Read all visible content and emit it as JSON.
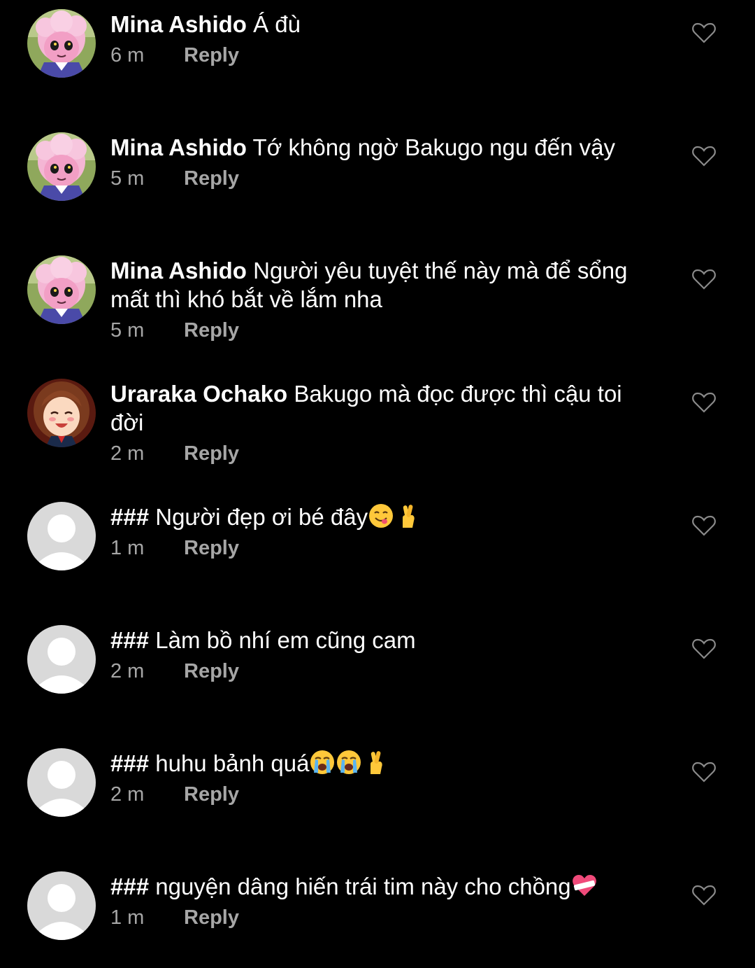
{
  "reply_label": "Reply",
  "comments": [
    {
      "author": "Mina Ashido",
      "text": "Á đù",
      "time": "6 m",
      "avatar": "pink-anime-avatar",
      "emojis": []
    },
    {
      "author": "Mina Ashido",
      "text": "Tớ không ngờ Bakugo ngu đến vậy",
      "time": "5 m",
      "avatar": "pink-anime-avatar",
      "emojis": []
    },
    {
      "author": "Mina Ashido",
      "text": "Người yêu tuyệt thế này mà để sổng mất thì khó bắt về lắm nha",
      "time": "5 m",
      "avatar": "pink-anime-avatar",
      "emojis": []
    },
    {
      "author": "Uraraka Ochako",
      "text": "Bakugo mà đọc được thì cậu toi đời",
      "time": "2 m",
      "avatar": "brown-hair-anime-avatar",
      "emojis": []
    },
    {
      "author": "###",
      "text": "Người đẹp ơi bé đây",
      "time": "1 m",
      "avatar": "default-avatar",
      "emojis": [
        "yum-face-emoji",
        "crossed-fingers-emoji"
      ]
    },
    {
      "author": "###",
      "text": "Làm bồ nhí em cũng cam",
      "time": "2 m",
      "avatar": "default-avatar",
      "emojis": []
    },
    {
      "author": "###",
      "text": "huhu bảnh quá",
      "time": "2 m",
      "avatar": "default-avatar",
      "emojis": [
        "crying-face-emoji",
        "crying-face-emoji",
        "crossed-fingers-emoji"
      ]
    },
    {
      "author": "###",
      "text": "nguyện dâng hiến trái tim này cho chồng",
      "time": "1 m",
      "avatar": "default-avatar",
      "emojis": [
        "mending-heart-emoji"
      ]
    }
  ],
  "colors": {
    "background": "#000000",
    "text": "#ffffff",
    "secondary_text": "#a6a6a6",
    "like_icon": "#8a8a8a",
    "default_avatar": "#d9d9d9"
  }
}
